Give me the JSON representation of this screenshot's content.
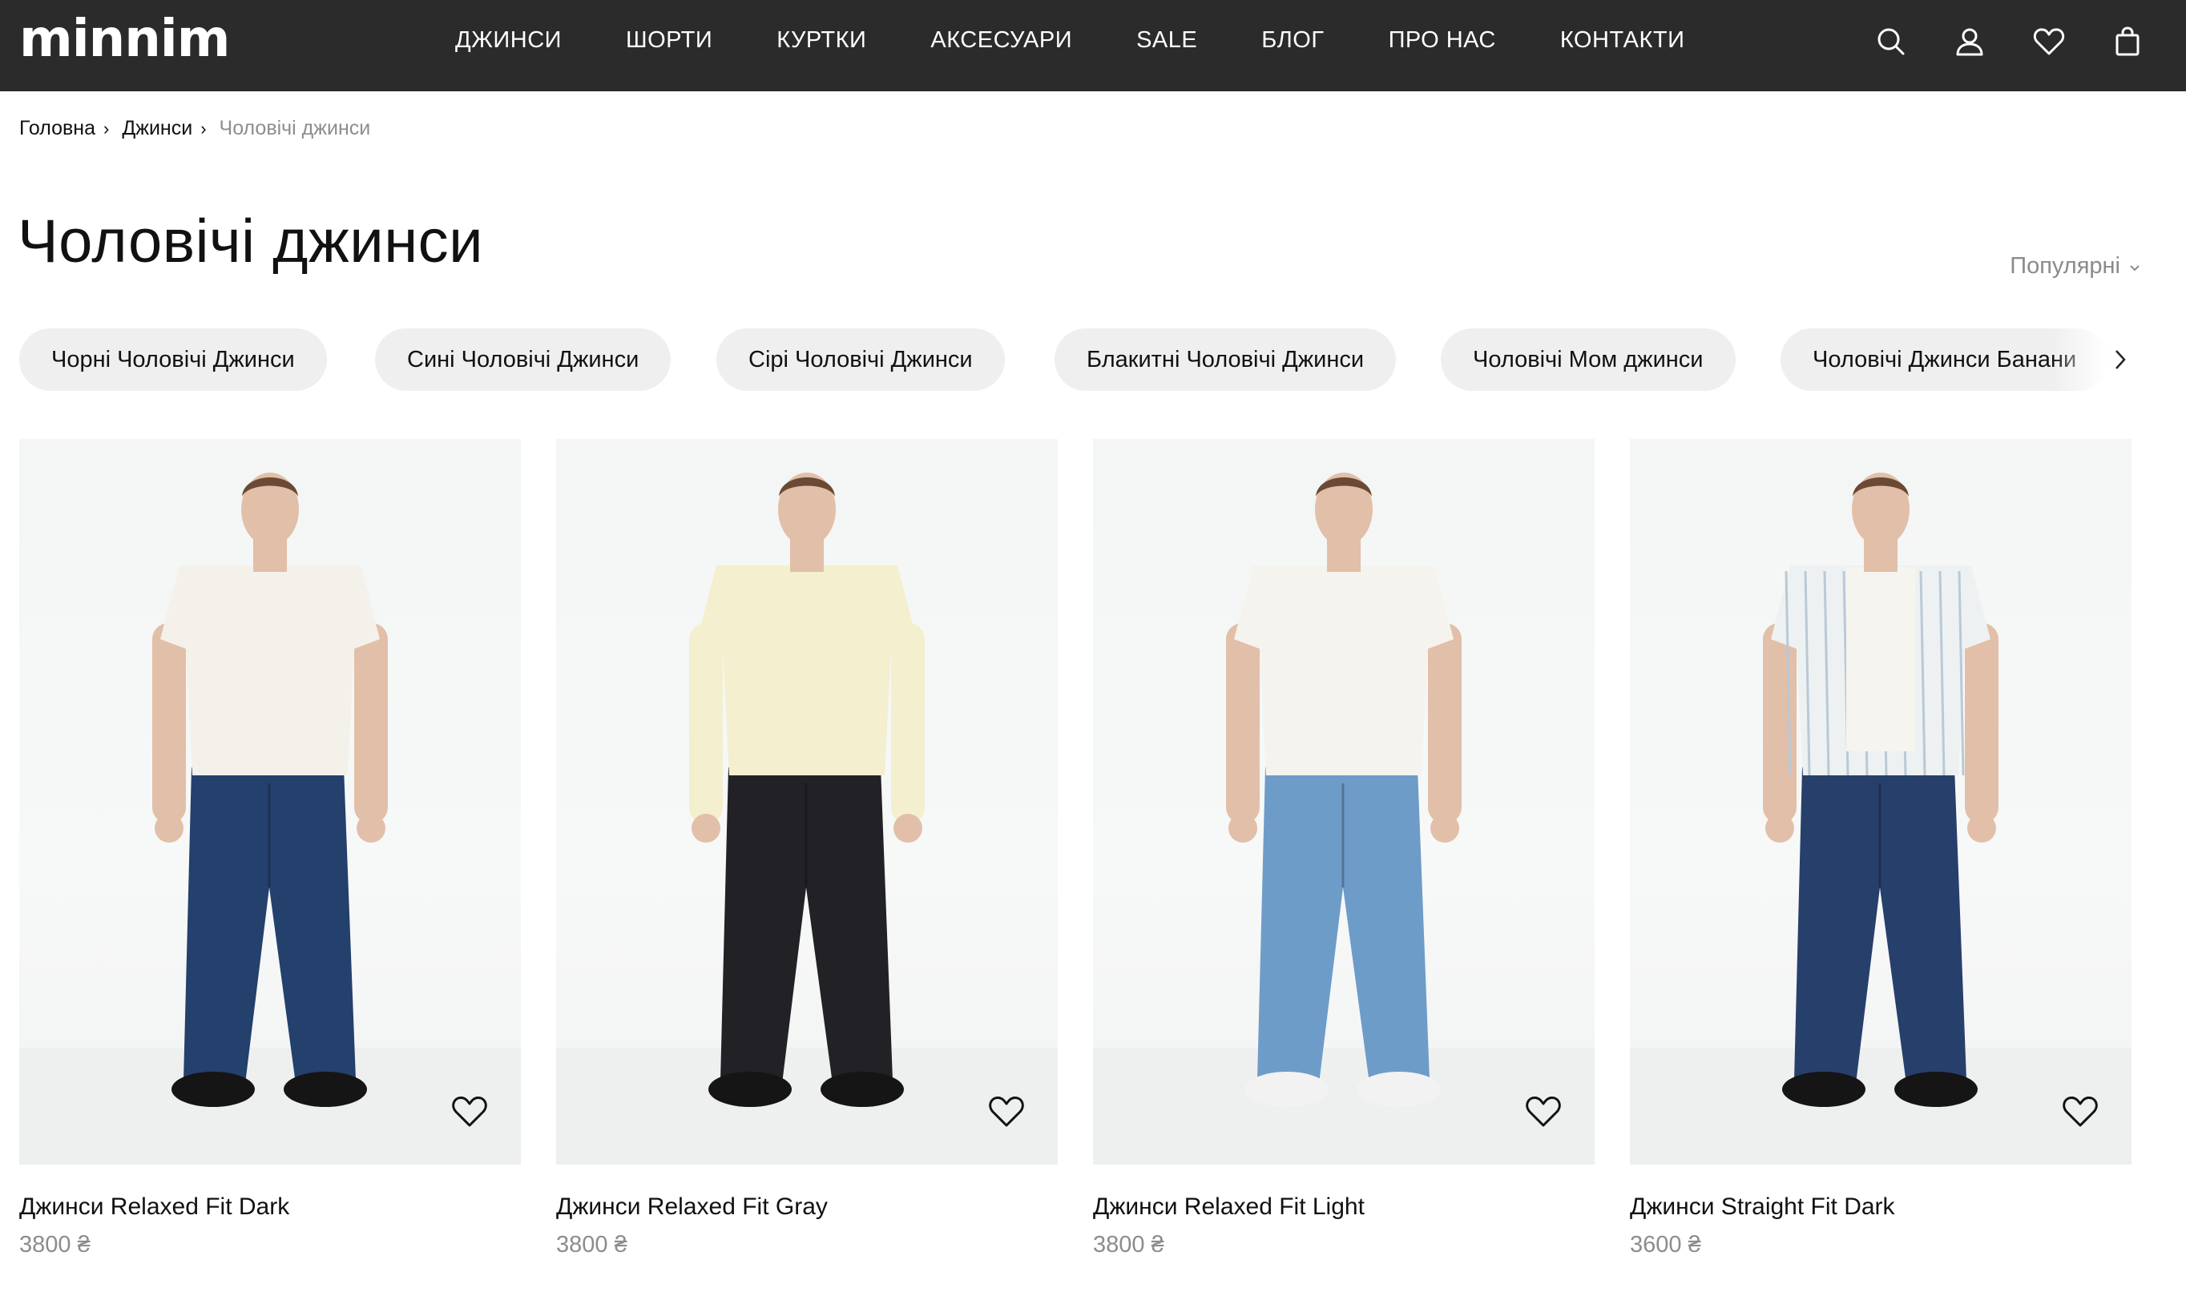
{
  "brand": {
    "logo_text": "minnim"
  },
  "nav": {
    "items": [
      "ДЖИНСИ",
      "ШОРТИ",
      "КУРТКИ",
      "АКСЕСУАРИ",
      "SALE",
      "БЛОГ",
      "ПРО НАС",
      "КОНТАКТИ"
    ]
  },
  "header_icons": [
    "search-icon",
    "user-icon",
    "heart-icon",
    "bag-icon"
  ],
  "breadcrumb": {
    "items": [
      "Головна",
      "Джинси"
    ],
    "current": "Чоловічі джинси",
    "separator": "›"
  },
  "page": {
    "title": "Чоловічі джинси",
    "sort_label": "Популярні"
  },
  "chips": [
    "Чорні Чоловічі Джинси",
    "Сині Чоловічі Джинси",
    "Сірі Чоловічі Джинси",
    "Блакитні Чоловічі Джинси",
    "Чоловічі Мом джинси",
    "Чоловічі Джинси Банани"
  ],
  "products": [
    {
      "name": "Джинси Relaxed Fit Dark",
      "price": "3800 ₴",
      "top_color": "#f3f1ea",
      "jeans_color": "#24406c",
      "shoe_color": "#151515"
    },
    {
      "name": "Джинси Relaxed Fit Gray",
      "price": "3800 ₴",
      "top_color": "#f3efcf",
      "jeans_color": "#222226",
      "shoe_color": "#151515"
    },
    {
      "name": "Джинси Relaxed Fit Light",
      "price": "3800 ₴",
      "top_color": "#f5f3ee",
      "jeans_color": "#6e9cc8",
      "shoe_color": "#f2f2f2"
    },
    {
      "name": "Джинси Straight Fit Dark",
      "price": "3600 ₴",
      "top_color": "#eef1f2",
      "jeans_color": "#273f6b",
      "shoe_color": "#151515"
    }
  ],
  "colors": {
    "header_bg": "#2b2b2b",
    "chip_bg": "#efefef",
    "price_text": "#8c8c8c"
  }
}
